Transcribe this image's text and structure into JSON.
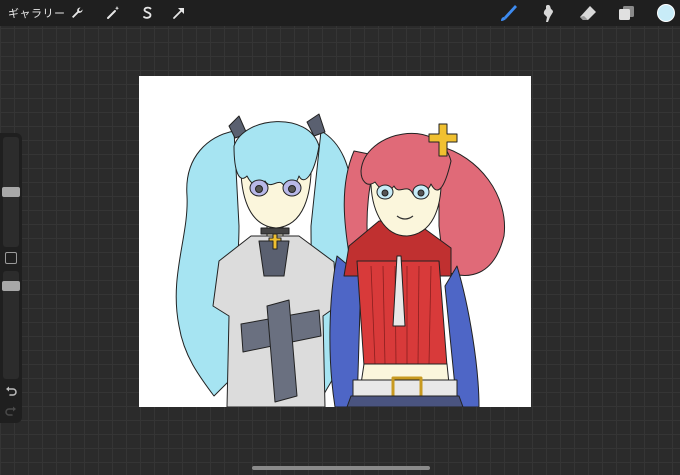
{
  "topbar": {
    "gallery_label": "ギャラリー",
    "left_tools": [
      {
        "icon": "wrench-icon"
      },
      {
        "icon": "magic-wand-icon"
      },
      {
        "icon": "selection-icon"
      },
      {
        "icon": "transform-arrow-icon"
      }
    ],
    "right_tools": [
      {
        "icon": "brush-icon",
        "active": true
      },
      {
        "icon": "smudge-icon"
      },
      {
        "icon": "eraser-icon"
      },
      {
        "icon": "layers-icon"
      }
    ],
    "current_color": "#c8ecf8"
  },
  "sidebar": {
    "size_slider": {
      "level": 0.5
    },
    "opacity_slider": {
      "level": 0.1
    },
    "icons": [
      "modifier-square-icon",
      "undo-icon",
      "redo-icon"
    ]
  },
  "canvas": {
    "background": "#ffffff",
    "artwork": "two-anime-girls-illustration",
    "palette": {
      "blue_hair": "#a6e4f2",
      "red_hair": "#e06a78",
      "red_top": "#d83a3a",
      "sleeve": "#4e66c6",
      "gray_top": "#dcdcdc",
      "dark_cross": "#6a7080",
      "skin": "#fbf6dc",
      "gold": "#f0c030"
    }
  }
}
